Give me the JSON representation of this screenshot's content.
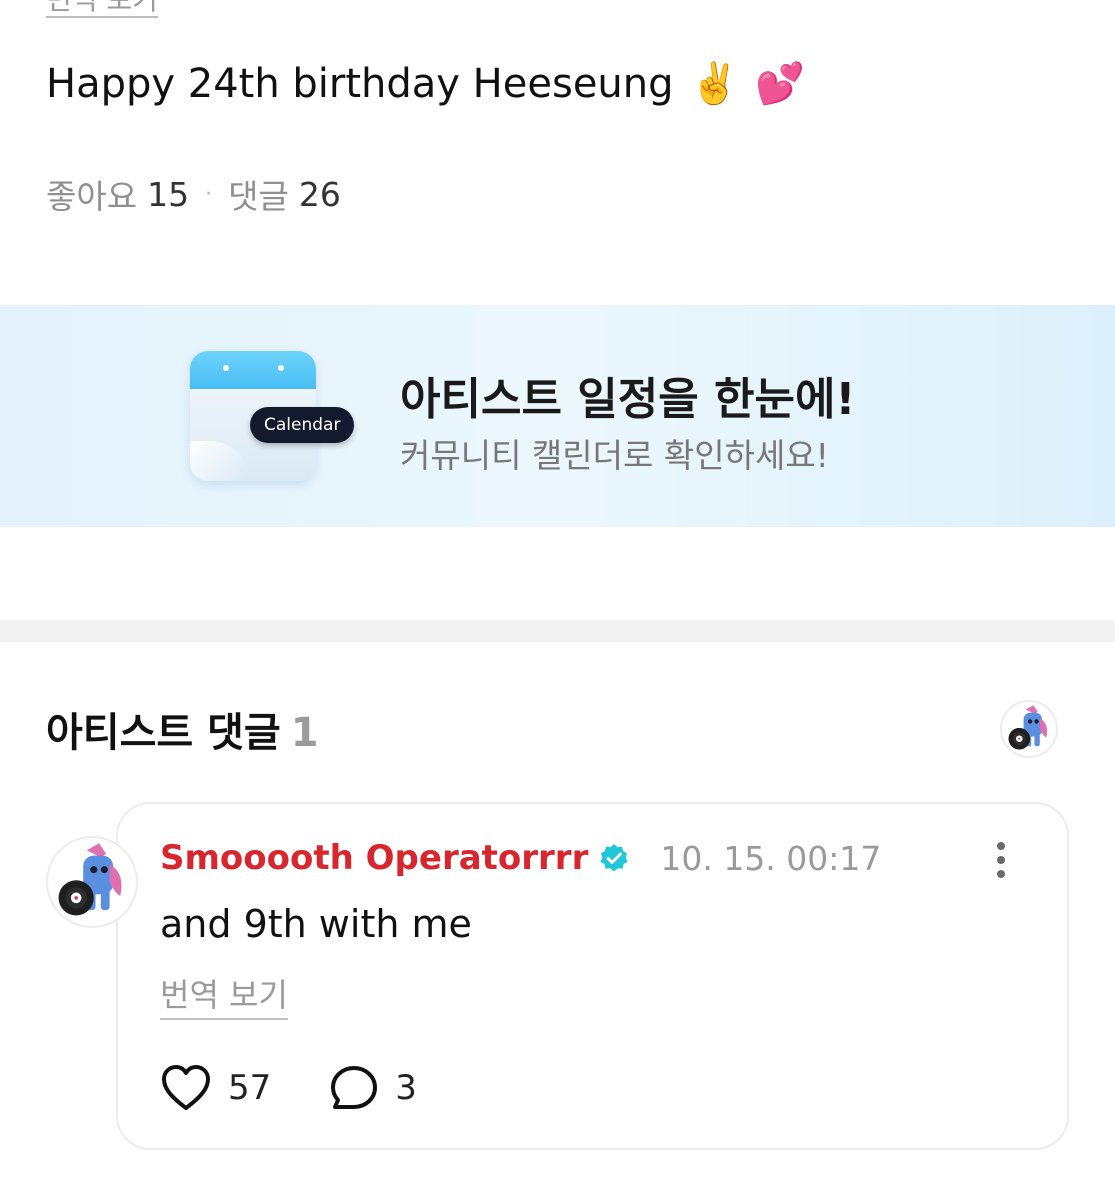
{
  "post": {
    "top_link_label": "번역 보기",
    "text": "Happy 24th birthday Heeseung",
    "emojis": [
      "✌️",
      "💕"
    ],
    "likes_label": "좋아요",
    "likes_count": "15",
    "separator": "·",
    "comments_label": "댓글",
    "comments_count": "26"
  },
  "banner": {
    "calendar_label": "Calendar",
    "title": "아티스트 일정을 한눈에!",
    "subtitle": "커뮤니티 캘린더로 확인하세요!",
    "colors": {
      "calendar_top": "#48bdf2",
      "pill": "#131a2e"
    }
  },
  "artist_comments": {
    "title": "아티스트 댓글",
    "count": "1"
  },
  "comment": {
    "author": "Smooooth Operatorrrr",
    "verified_icon": "verified-badge-icon",
    "timestamp": "10. 15. 00:17",
    "body": "and 9th with me",
    "translate_label": "번역 보기",
    "likes": "57",
    "replies": "3",
    "colors": {
      "author": "#d8262e",
      "verified": "#1ec8d8"
    }
  }
}
